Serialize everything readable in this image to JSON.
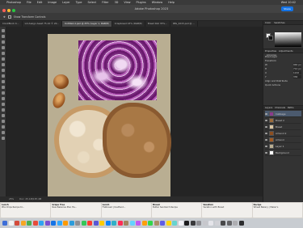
{
  "menubar": {
    "items": [
      "Photoshop",
      "File",
      "Edit",
      "Image",
      "Layer",
      "Type",
      "Select",
      "Filter",
      "3D",
      "View",
      "Plugins",
      "Window",
      "Help"
    ],
    "right": "Wed 10:42"
  },
  "titlebar": {
    "title": "Adobe Photoshop 2023",
    "share_label": "Share"
  },
  "options": {
    "label": "Show Transform Controls"
  },
  "document_tabs": [
    "ClockBlock K...",
    "Lid Assign Asset 75-10 © 20...",
    "Untitled-4.psd @ 25% (Layer 1, RGB/8)",
    "Crispbread 43% (RGB/8)",
    "Bread Roll 33%...",
    "IMG_4215.psd @ ..."
  ],
  "status": {
    "zoom": "25%",
    "doc": "Doc: 25.1M/187.4M"
  },
  "panel": {
    "color_tab": "Color",
    "swatches_tab": "Swatches",
    "properties_tab": "Properties",
    "adjustments_tab": "Adjustments",
    "libraries_tab": "Libraries",
    "props_section": "Pixel Layer",
    "rows": [
      {
        "label": "Transform",
        "value": ""
      },
      {
        "label": "W",
        "value": "940 px"
      },
      {
        "label": "H",
        "value": "712 px"
      },
      {
        "label": "X",
        "value": "1210"
      },
      {
        "label": "Y",
        "value": "330"
      },
      {
        "label": "Align and Distribute",
        "value": ""
      },
      {
        "label": "Quick Actions",
        "value": ""
      }
    ],
    "layers_tab": "Layers",
    "channels_tab": "Channels",
    "paths_tab": "Paths",
    "layers": [
      {
        "name": "Cabbage",
        "color": "#8a3b8d"
      },
      {
        "name": "Bread 2",
        "color": "#9a6a3a"
      },
      {
        "name": "Bread",
        "color": "#d9c5a2"
      },
      {
        "name": "Almond 2",
        "color": "#8d4e1f"
      },
      {
        "name": "Almond",
        "color": "#a05a22"
      },
      {
        "name": "Layer 1",
        "color": "#b9ae92"
      },
      {
        "name": "Background",
        "color": "#ffffff"
      }
    ]
  },
  "taskbar": [
    {
      "title": "Lunch",
      "sub": "Pita Chips Recipe Kr..."
    },
    {
      "title": "Grape Tree",
      "sub": "New Bakeries Plan Ha..."
    },
    {
      "title": "Lunch",
      "sub": "Flatbread | Kaufland..."
    },
    {
      "title": "Bread",
      "sub": "Butter Sandwich Recipe"
    },
    {
      "title": "Vacation",
      "sub": "Vacation with Bread"
    },
    {
      "title": "Recipe",
      "sub": "Wheat Bakery | Maker's"
    }
  ],
  "colors": {
    "dock": [
      "#3d6ed8",
      "#f2f2f2",
      "#d44b3b",
      "#f6a623",
      "#4caf50",
      "#e74c3c",
      "#2ea3f2",
      "#7b4fd1",
      "#1473e6",
      "#31a8ff",
      "#ff9a00",
      "#2c9cdb",
      "#8e8e93",
      "#34c759",
      "#ff3b30",
      "#5856d6",
      "#ffcc00",
      "#0a84ff",
      "#30b0c7",
      "#ff2d55",
      "#a2845e",
      "#64d2ff",
      "#bf5af2",
      "#ff9f0a",
      "#32d74b",
      "#ac8e68",
      "#5e5ce6",
      "#ffd60a",
      "#66d4cf",
      "#f2f2f7",
      "#1c1c1e",
      "#3a3a3c",
      "#8e8e93",
      "#c7c7cc",
      "#e5e5ea",
      "#d1d1d6",
      "#48484a",
      "#636366",
      "#aeaeb2",
      "#2c2c2e"
    ]
  }
}
